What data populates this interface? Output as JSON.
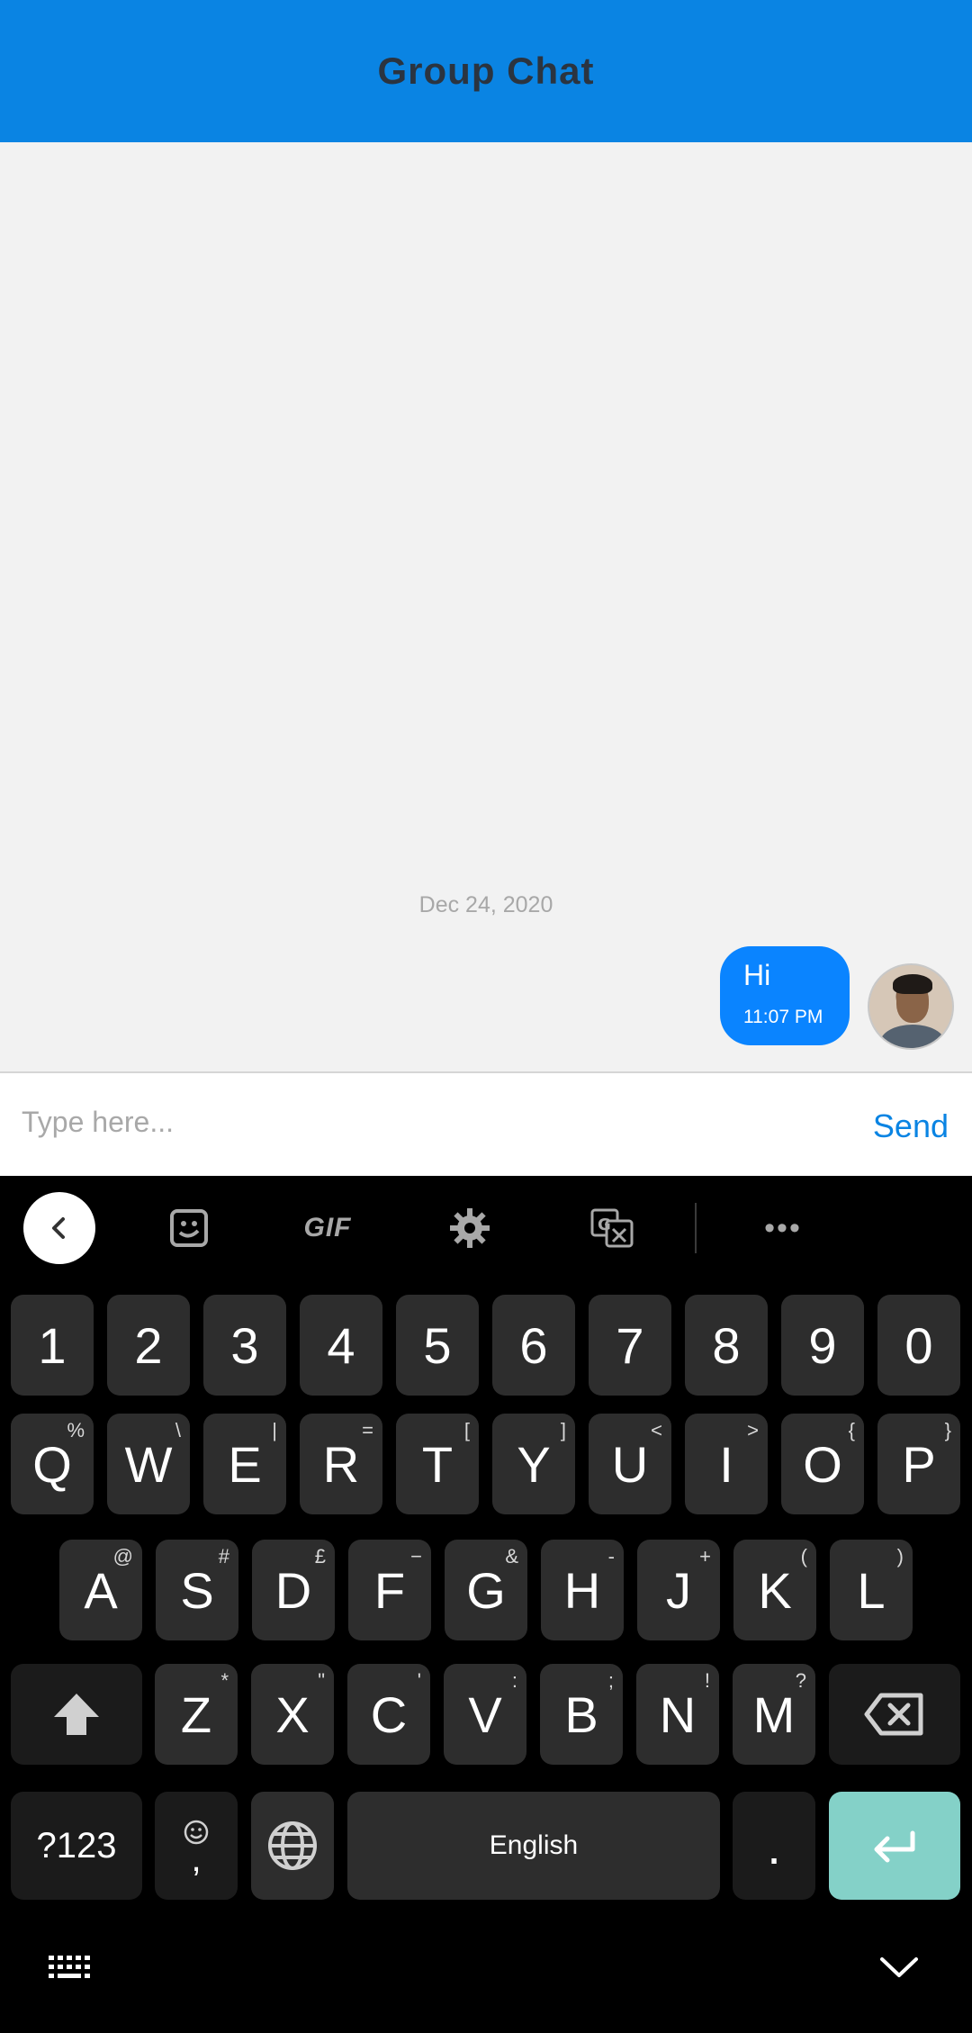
{
  "header": {
    "title": "Group Chat"
  },
  "chat": {
    "date_separator": "Dec 24, 2020",
    "messages": [
      {
        "text": "Hi",
        "time": "11:07 PM"
      }
    ]
  },
  "composer": {
    "placeholder": "Type here...",
    "send_label": "Send"
  },
  "keyboard": {
    "toolbar": {
      "icons": [
        "back-icon",
        "sticker-icon",
        "gif-icon",
        "settings-icon",
        "translate-icon",
        "more-icon"
      ],
      "gif_label": "GIF",
      "more_label": "•••"
    },
    "number_row": [
      "1",
      "2",
      "3",
      "4",
      "5",
      "6",
      "7",
      "8",
      "9",
      "0"
    ],
    "row1": [
      {
        "k": "Q",
        "h": "%"
      },
      {
        "k": "W",
        "h": "\\"
      },
      {
        "k": "E",
        "h": "|"
      },
      {
        "k": "R",
        "h": "="
      },
      {
        "k": "T",
        "h": "["
      },
      {
        "k": "Y",
        "h": "]"
      },
      {
        "k": "U",
        "h": "<"
      },
      {
        "k": "I",
        "h": ">"
      },
      {
        "k": "O",
        "h": "{"
      },
      {
        "k": "P",
        "h": "}"
      }
    ],
    "row2": [
      {
        "k": "A",
        "h": "@"
      },
      {
        "k": "S",
        "h": "#"
      },
      {
        "k": "D",
        "h": "£"
      },
      {
        "k": "F",
        "h": "−"
      },
      {
        "k": "G",
        "h": "&"
      },
      {
        "k": "H",
        "h": "-"
      },
      {
        "k": "J",
        "h": "+"
      },
      {
        "k": "K",
        "h": "("
      },
      {
        "k": "L",
        "h": ")"
      }
    ],
    "row3": [
      {
        "k": "Z",
        "h": "*"
      },
      {
        "k": "X",
        "h": "\""
      },
      {
        "k": "C",
        "h": "'"
      },
      {
        "k": "V",
        "h": ":"
      },
      {
        "k": "B",
        "h": ";"
      },
      {
        "k": "N",
        "h": "!"
      },
      {
        "k": "M",
        "h": "?"
      }
    ],
    "bottom": {
      "symbols_label": "?123",
      "emoji_sub": ",",
      "space_label": "English",
      "period_label": "."
    }
  },
  "colors": {
    "header": "#0a84e3",
    "bubble": "#0a84ff",
    "enter_key": "#84d1c8"
  }
}
